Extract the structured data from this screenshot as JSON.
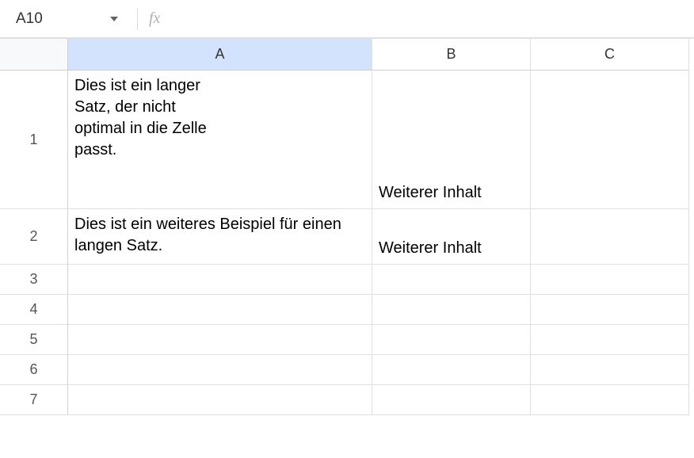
{
  "formulaBar": {
    "nameBox": "A10",
    "fxLabel": "fx",
    "formula": ""
  },
  "columns": [
    "A",
    "B",
    "C"
  ],
  "selectedColumn": "A",
  "rows": [
    {
      "num": "1",
      "heightClass": "row-tall1",
      "cells": {
        "A": "Dies ist ein langer Satz, der nicht optimal in die Zelle passt.",
        "B": "Weiterer Inhalt",
        "C": ""
      },
      "aWrapped": true
    },
    {
      "num": "2",
      "heightClass": "row-tall2",
      "cells": {
        "A": "Dies ist ein weiteres Beispiel für einen langen Satz.",
        "B": "Weiterer Inhalt",
        "C": ""
      },
      "aWrapped": false
    },
    {
      "num": "3",
      "heightClass": "row-std",
      "cells": {
        "A": "",
        "B": "",
        "C": ""
      }
    },
    {
      "num": "4",
      "heightClass": "row-std",
      "cells": {
        "A": "",
        "B": "",
        "C": ""
      }
    },
    {
      "num": "5",
      "heightClass": "row-std",
      "cells": {
        "A": "",
        "B": "",
        "C": ""
      }
    },
    {
      "num": "6",
      "heightClass": "row-std",
      "cells": {
        "A": "",
        "B": "",
        "C": ""
      }
    },
    {
      "num": "7",
      "heightClass": "row-std",
      "cells": {
        "A": "",
        "B": "",
        "C": ""
      }
    }
  ]
}
